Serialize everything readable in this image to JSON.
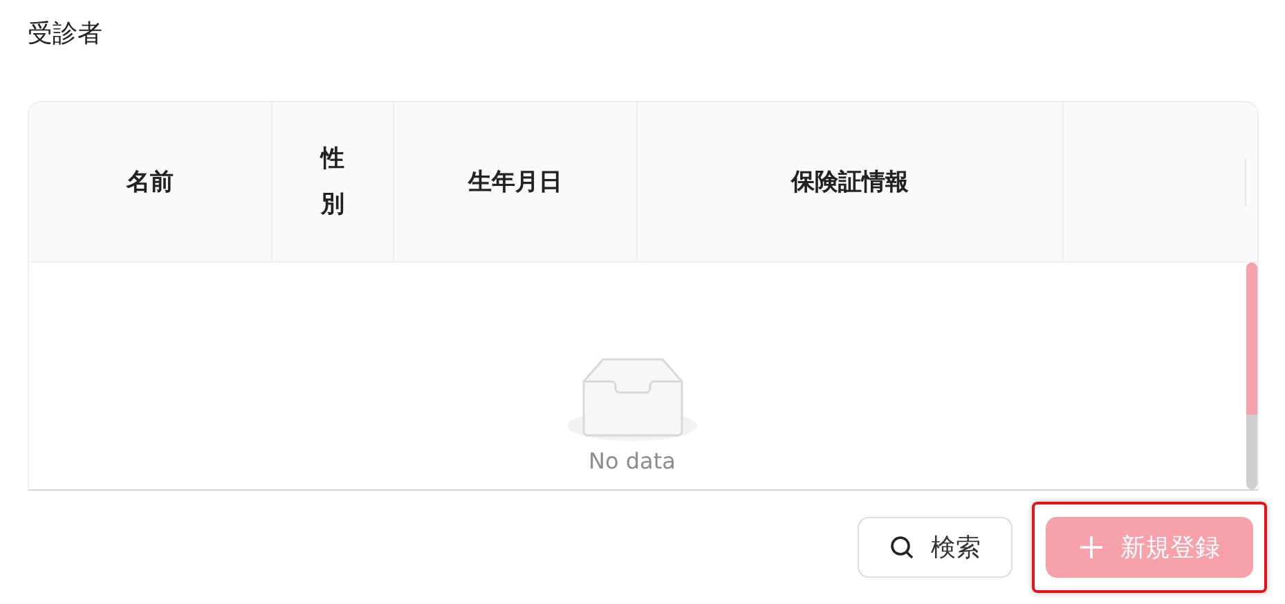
{
  "page_title": "受診者",
  "table": {
    "columns": [
      {
        "label": "名前",
        "kind": "normal"
      },
      {
        "label": "性別",
        "kind": "narrow"
      },
      {
        "label": "生年月日",
        "kind": "normal"
      },
      {
        "label": "保険証情報",
        "kind": "wide"
      }
    ],
    "empty_text": "No data"
  },
  "buttons": [
    {
      "label": "検索",
      "kind": "search",
      "highlighted": false
    },
    {
      "label": "新規登録",
      "kind": "primary",
      "highlighted": true
    }
  ]
}
